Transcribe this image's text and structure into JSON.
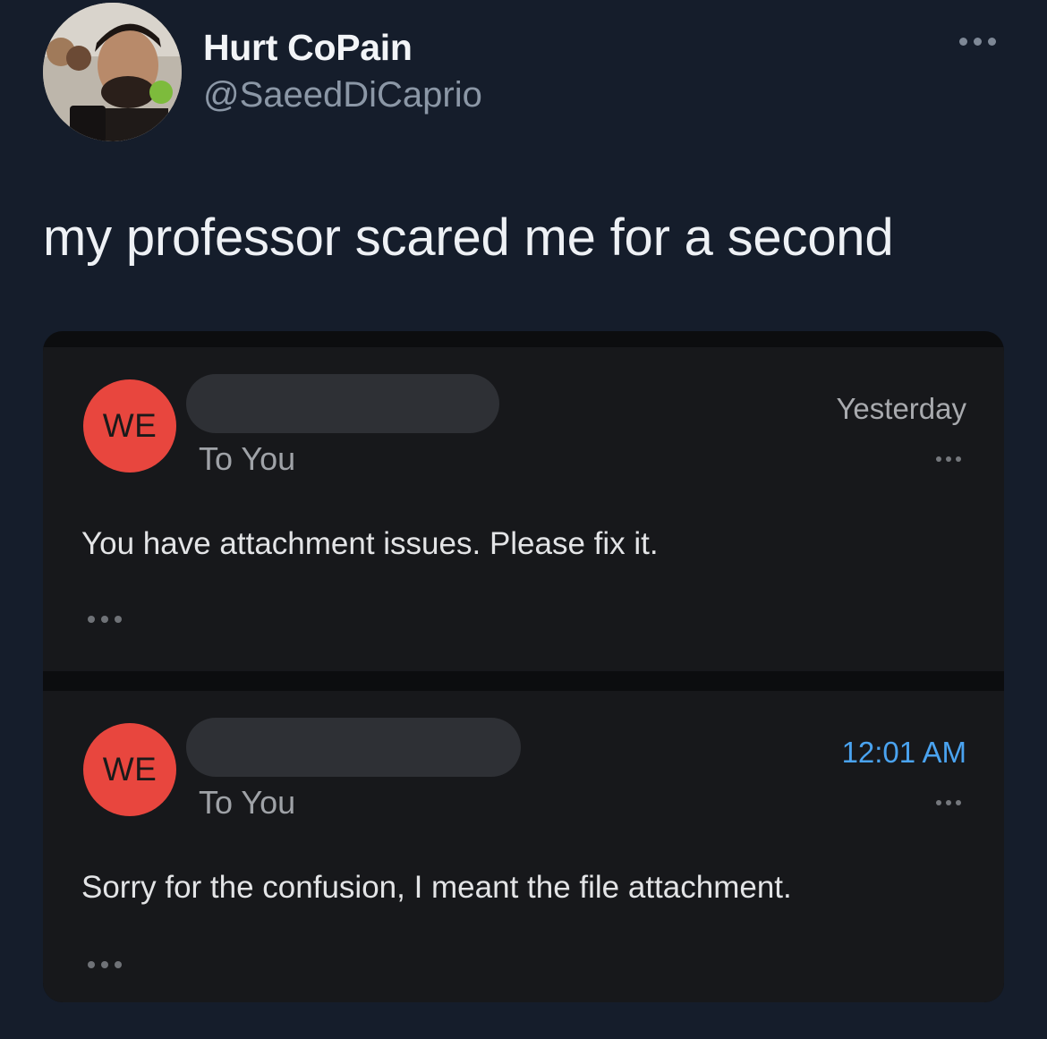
{
  "tweet": {
    "display_name": "Hurt CoPain",
    "handle": "@SaeedDiCaprio",
    "text": "my professor scared me for a second",
    "more_icon": "ellipsis-icon"
  },
  "emails": [
    {
      "avatar_initials": "WE",
      "recipient": "To You",
      "time": "Yesterday",
      "body": "You have attachment issues. Please fix it."
    },
    {
      "avatar_initials": "WE",
      "recipient": "To You",
      "time": "12:01 AM",
      "body": "Sorry for the confusion, I meant the file attachment."
    }
  ],
  "colors": {
    "background": "#151d2b",
    "email_card": "#17181b",
    "avatar_red": "#e8463e",
    "time_blue": "#4aa3f0"
  }
}
